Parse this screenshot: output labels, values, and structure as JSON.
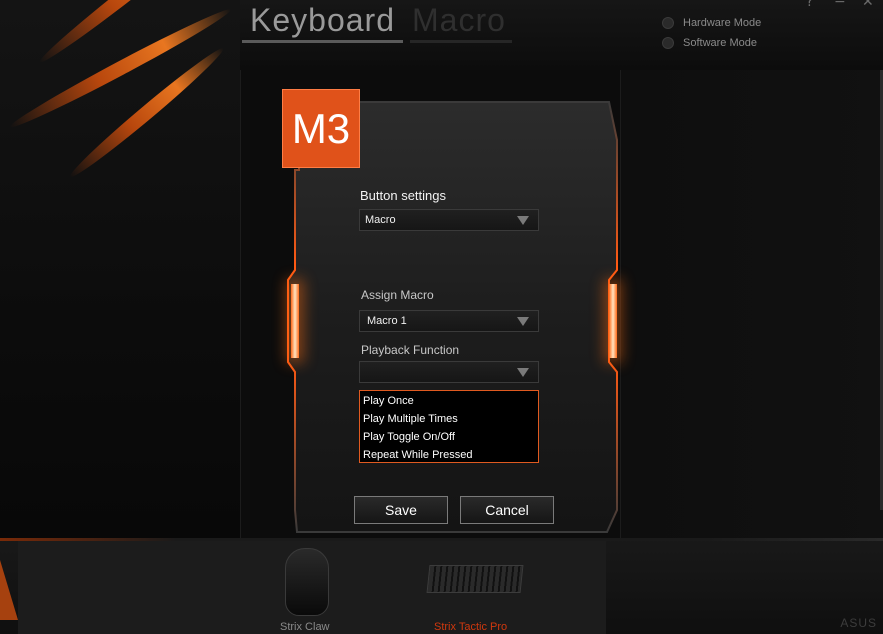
{
  "header": {
    "tabs": [
      {
        "label": "Keyboard",
        "active": true
      },
      {
        "label": "Macro",
        "active": false
      }
    ],
    "modes": [
      {
        "label": "Hardware Mode",
        "selected": false
      },
      {
        "label": "Software Mode",
        "selected": false
      }
    ],
    "window_buttons": {
      "help": "?",
      "minimize": "−",
      "close": "✕"
    }
  },
  "dialog": {
    "badge": "M3",
    "button_settings_label": "Button settings",
    "button_settings_value": "Macro",
    "assign_macro_label": "Assign Macro",
    "assign_macro_value": "Macro 1",
    "playback_label": "Playback Function",
    "playback_value": "",
    "playback_options": [
      "Play Once",
      "Play Multiple Times",
      "Play Toggle On/Off",
      "Repeat While Pressed"
    ],
    "save_label": "Save",
    "cancel_label": "Cancel"
  },
  "devices": [
    {
      "name": "Strix Claw",
      "selected": false
    },
    {
      "name": "Strix Tactic Pro",
      "selected": true
    }
  ],
  "brand": "ASUS",
  "colors": {
    "accent": "#e0521a",
    "selected_device": "#d0380e",
    "device_text": "#8a8a8a"
  }
}
